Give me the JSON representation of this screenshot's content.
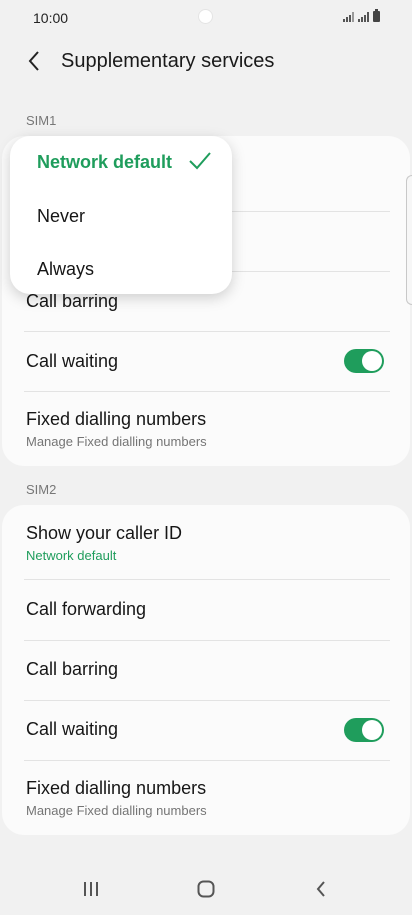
{
  "status_bar": {
    "time": "10:00"
  },
  "header": {
    "title": "Supplementary services"
  },
  "sim1": {
    "label": "SIM1",
    "rows": [
      {
        "title": "Call barring"
      },
      {
        "title": "Call waiting",
        "toggle": true
      },
      {
        "title": "Fixed dialling numbers",
        "subtitle": "Manage Fixed dialling numbers"
      }
    ]
  },
  "sim2": {
    "label": "SIM2",
    "rows": [
      {
        "title": "Show your caller ID",
        "subtitle": "Network default"
      },
      {
        "title": "Call forwarding"
      },
      {
        "title": "Call barring"
      },
      {
        "title": "Call waiting",
        "toggle": true
      },
      {
        "title": "Fixed dialling numbers",
        "subtitle": "Manage Fixed dialling numbers"
      }
    ]
  },
  "popup": {
    "options": [
      "Network default",
      "Never",
      "Always"
    ],
    "selected": "Network default"
  },
  "colors": {
    "accent": "#1f9d5c",
    "background": "#f1f1f1",
    "card": "#fbfbfb"
  }
}
